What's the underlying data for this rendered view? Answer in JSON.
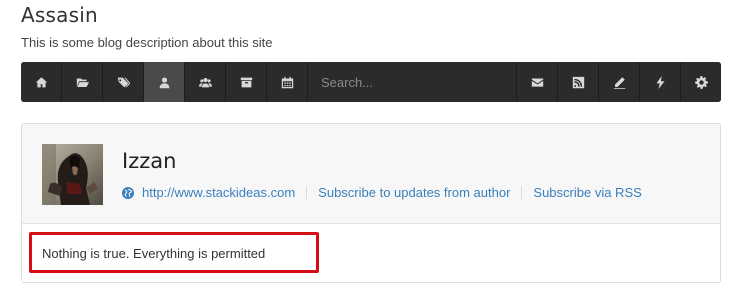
{
  "site": {
    "title": "Assasin",
    "description": "This is some blog description about this site"
  },
  "toolbar": {
    "search_placeholder": "Search...",
    "left_icons": [
      "home-icon",
      "folder-open-icon",
      "tags-icon",
      "user-icon",
      "users-icon",
      "archive-icon",
      "calendar-icon"
    ],
    "active_index": 3,
    "right_icons": [
      "envelope-icon",
      "rss-icon",
      "pencil-icon",
      "bolt-icon",
      "gear-icon"
    ]
  },
  "author": {
    "name": "Izzan",
    "website": "http://www.stackideas.com",
    "subscribe_author": "Subscribe to updates from author",
    "subscribe_rss": "Subscribe via RSS",
    "bio": "Nothing is true. Everything is permitted"
  },
  "colors": {
    "toolbar_bg": "#2b2b2b",
    "link": "#3a7fbd",
    "highlight": "#d40e14"
  }
}
